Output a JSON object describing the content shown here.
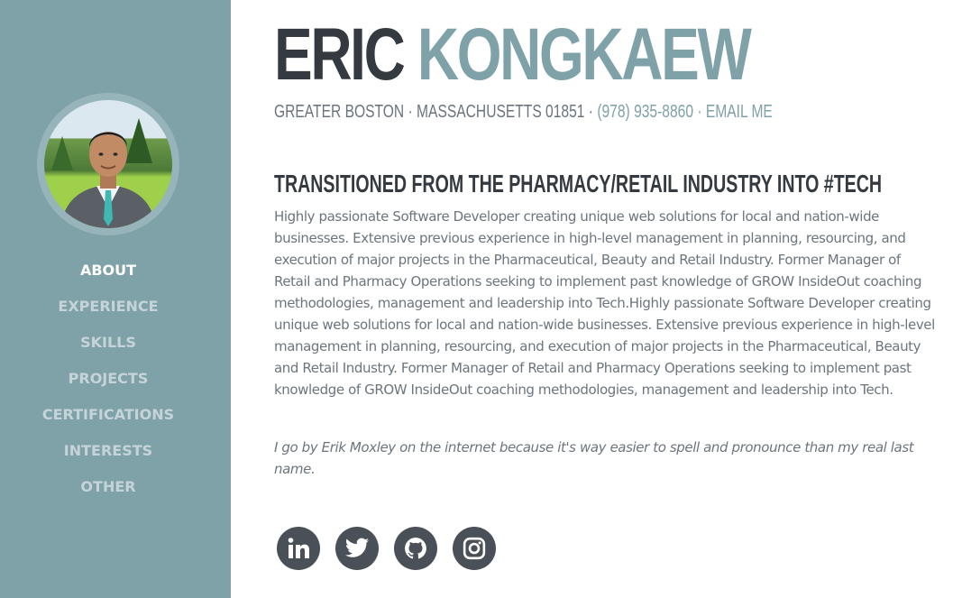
{
  "sidebar": {
    "nav": [
      {
        "label": "ABOUT",
        "active": true
      },
      {
        "label": "EXPERIENCE",
        "active": false
      },
      {
        "label": "SKILLS",
        "active": false
      },
      {
        "label": "PROJECTS",
        "active": false
      },
      {
        "label": "CERTIFICATIONS",
        "active": false
      },
      {
        "label": "INTERESTS",
        "active": false
      },
      {
        "label": "OTHER",
        "active": false
      }
    ]
  },
  "header": {
    "first_name": "ERIC",
    "last_name": "KONGKAEW",
    "address": "GREATER BOSTON · MASSACHUSETTS 01851 · ",
    "phone": "(978) 935-8860",
    "separator": " · ",
    "email_label": "EMAIL ME"
  },
  "about": {
    "headline": "Transitioned from the Pharmacy/Retail Industry into #Tech",
    "bio": "Highly passionate Software Developer creating unique web solutions for local and nation-wide businesses. Extensive previous experience in high-level management in planning, resourcing, and execution of major projects in the Pharmaceutical, Beauty and Retail Industry. Former Manager of Retail and Pharmacy Operations seeking to implement past knowledge of GROW InsideOut coaching methodologies, management and leadership into Tech.Highly passionate Software Developer creating unique web solutions for local and nation-wide businesses. Extensive previous experience in high-level management in planning, resourcing, and execution of major projects in the Pharmaceutical, Beauty and Retail Industry. Former Manager of Retail and Pharmacy Operations seeking to implement past knowledge of GROW InsideOut coaching methodologies, management and leadership into Tech.",
    "note": "I go by Erik Moxley on the internet because it's way easier to spell and pronounce than my real last name."
  },
  "social": [
    "linkedin-icon",
    "twitter-icon",
    "github-icon",
    "instagram-icon"
  ],
  "colors": {
    "sidebar": "#7fa1a8",
    "accent": "#7fa1a8",
    "dark": "#343a40",
    "text": "#6c757d",
    "icon_bg": "#495057"
  }
}
